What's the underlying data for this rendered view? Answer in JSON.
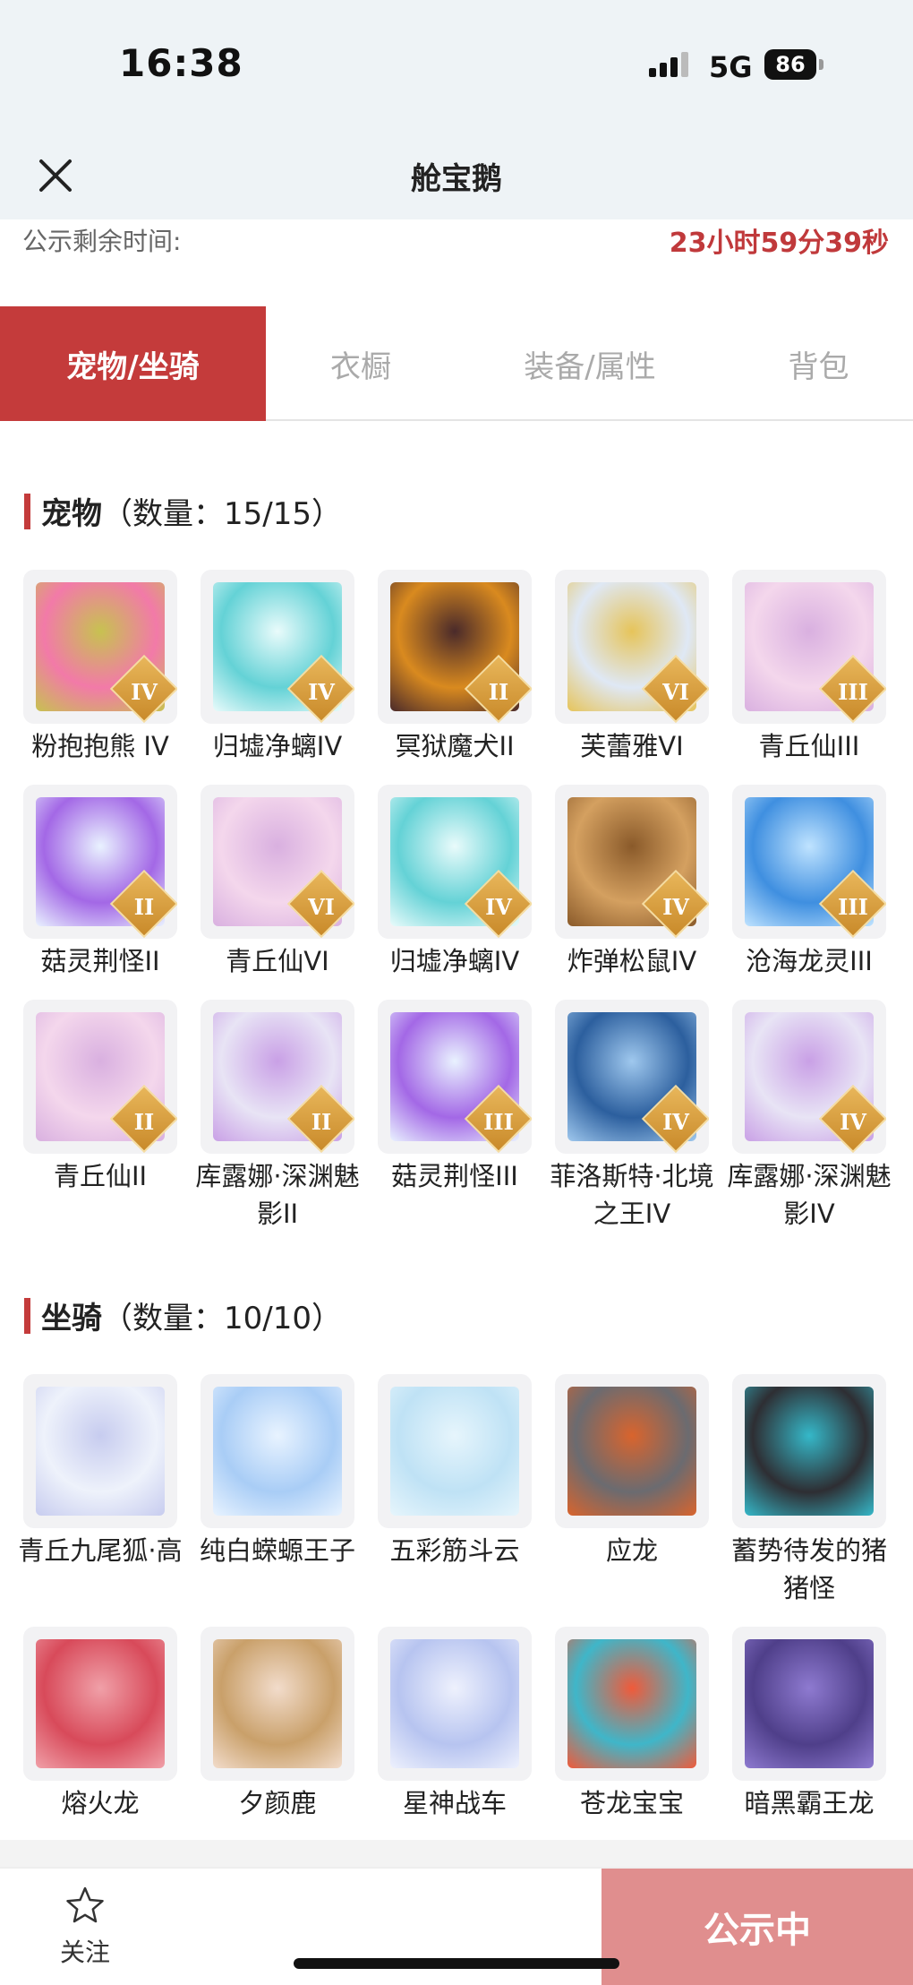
{
  "status_bar": {
    "time": "16:38",
    "network": "5G",
    "battery": "86"
  },
  "header": {
    "title": "舱宝鹅"
  },
  "countdown": {
    "label": "公示剩余时间:",
    "value": "23小时59分39秒"
  },
  "tabs": [
    {
      "label": "宠物/坐骑",
      "active": true
    },
    {
      "label": "衣橱",
      "active": false
    },
    {
      "label": "装备/属性",
      "active": false
    },
    {
      "label": "背包",
      "active": false
    }
  ],
  "pets_section": {
    "title": "宠物",
    "count": "（数量：15/15）",
    "items": [
      {
        "name": "粉抱抱熊 IV",
        "badge": "IV",
        "art": "pink-bear",
        "c1": "#f27aa8",
        "c2": "#c7c250"
      },
      {
        "name": "归墟净螭IV",
        "badge": "IV",
        "art": "teal-dragon",
        "c1": "#64d2d6",
        "c2": "#e9fbfb"
      },
      {
        "name": "冥狱魔犬II",
        "badge": "II",
        "art": "hell-hound",
        "c1": "#d98a1f",
        "c2": "#4a2a2a"
      },
      {
        "name": "芙蕾雅VI",
        "badge": "VI",
        "art": "freya",
        "c1": "#dfe8f5",
        "c2": "#e6c45a"
      },
      {
        "name": "青丘仙III",
        "badge": "III",
        "art": "fox-fairy",
        "c1": "#f4d7ec",
        "c2": "#d9b0e0"
      },
      {
        "name": "菇灵荆怪II",
        "badge": "II",
        "art": "mushroom-sprite",
        "c1": "#a368e6",
        "c2": "#e9f2ff"
      },
      {
        "name": "青丘仙VI",
        "badge": "VI",
        "art": "fox-fairy",
        "c1": "#f4d7ec",
        "c2": "#d9b0e0"
      },
      {
        "name": "归墟净螭IV",
        "badge": "IV",
        "art": "teal-dragon",
        "c1": "#64d2d6",
        "c2": "#e9fbfb"
      },
      {
        "name": "炸弹松鼠IV",
        "badge": "IV",
        "art": "bomb-squirrel",
        "c1": "#d4a060",
        "c2": "#8a5a2a"
      },
      {
        "name": "沧海龙灵III",
        "badge": "III",
        "art": "sea-dragon-spirit",
        "c1": "#3f8fe0",
        "c2": "#bfe3ff"
      },
      {
        "name": "青丘仙II",
        "badge": "II",
        "art": "fox-fairy",
        "c1": "#f4d7ec",
        "c2": "#d9b0e0"
      },
      {
        "name": "库露娜·深渊魅影II",
        "badge": "II",
        "art": "kuluna",
        "c1": "#e8e4f5",
        "c2": "#c9a0e6"
      },
      {
        "name": "菇灵荆怪III",
        "badge": "III",
        "art": "mushroom-sprite",
        "c1": "#a368e6",
        "c2": "#e9f2ff"
      },
      {
        "name": "菲洛斯特·北境之王IV",
        "badge": "IV",
        "art": "frost-king",
        "c1": "#2c5f9e",
        "c2": "#9fc8ee"
      },
      {
        "name": "库露娜·深渊魅影IV",
        "badge": "IV",
        "art": "kuluna",
        "c1": "#e8e4f5",
        "c2": "#c9a0e6"
      }
    ]
  },
  "mounts_section": {
    "title": "坐骑",
    "count": "（数量：10/10）",
    "items": [
      {
        "name": "青丘九尾狐·高",
        "art": "nine-tail-fox",
        "c1": "#eef2fb",
        "c2": "#c7ccef"
      },
      {
        "name": "纯白蝾螈王子",
        "art": "white-axolotl",
        "c1": "#a9cdf6",
        "c2": "#e8f3ff"
      },
      {
        "name": "五彩筋斗云",
        "art": "cloud",
        "c1": "#bfe2f5",
        "c2": "#e6f5fc"
      },
      {
        "name": "应龙",
        "art": "ying-dragon",
        "c1": "#6b6b70",
        "c2": "#d9642d"
      },
      {
        "name": "蓄势待发的猪猪怪",
        "art": "pig-monster",
        "c1": "#2e2e33",
        "c2": "#35b8c9"
      },
      {
        "name": "熔火龙",
        "art": "lava-dragon",
        "c1": "#d84a5a",
        "c2": "#f0a0a8"
      },
      {
        "name": "夕颜鹿",
        "art": "deer",
        "c1": "#c9a06a",
        "c2": "#f2dccb"
      },
      {
        "name": "星神战车",
        "art": "star-chariot",
        "c1": "#b7c4f0",
        "c2": "#eef1fd"
      },
      {
        "name": "苍龙宝宝",
        "art": "baby-dragon",
        "c1": "#3fb6c9",
        "c2": "#f05a3a"
      },
      {
        "name": "暗黑霸王龙",
        "art": "dark-trex",
        "c1": "#4f3f8a",
        "c2": "#8e7ad0"
      }
    ]
  },
  "footer": {
    "favorite_label": "关注",
    "publish_label": "公示中"
  }
}
